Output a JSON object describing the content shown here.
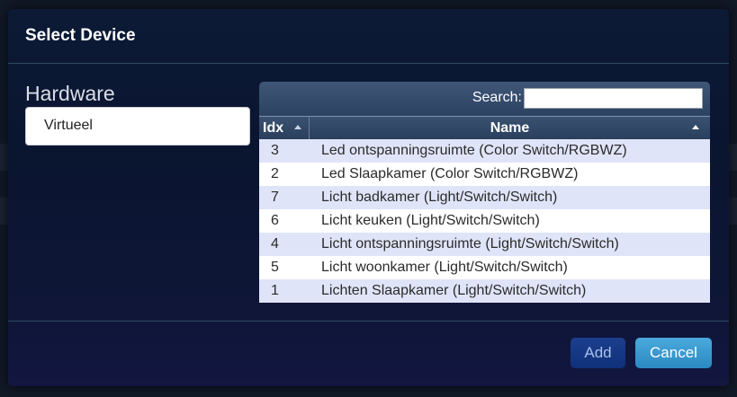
{
  "dialog": {
    "title": "Select Device"
  },
  "hardware": {
    "label": "Hardware",
    "selected": "Virtueel"
  },
  "table": {
    "search_label": "Search:",
    "search_value": "",
    "columns": {
      "idx": "Idx",
      "name": "Name"
    },
    "rows": [
      {
        "idx": "3",
        "name": "Led ontspanningsruimte (Color Switch/RGBWZ)"
      },
      {
        "idx": "2",
        "name": "Led Slaapkamer (Color Switch/RGBWZ)"
      },
      {
        "idx": "7",
        "name": "Licht badkamer (Light/Switch/Switch)"
      },
      {
        "idx": "6",
        "name": "Licht keuken (Light/Switch/Switch)"
      },
      {
        "idx": "4",
        "name": "Licht ontspanningsruimte (Light/Switch/Switch)"
      },
      {
        "idx": "5",
        "name": "Licht woonkamer (Light/Switch/Switch)"
      },
      {
        "idx": "1",
        "name": "Lichten Slaapkamer (Light/Switch/Switch)"
      }
    ]
  },
  "footer": {
    "add_label": "Add",
    "cancel_label": "Cancel"
  },
  "colors": {
    "row_odd": "#e0e4f8",
    "row_even": "#ffffff",
    "add_button": "#1c3f8e",
    "cancel_button": "#4aa9dc"
  },
  "icons": {
    "sort_idx": "sort-up-icon",
    "sort_name": "sort-up-icon"
  }
}
